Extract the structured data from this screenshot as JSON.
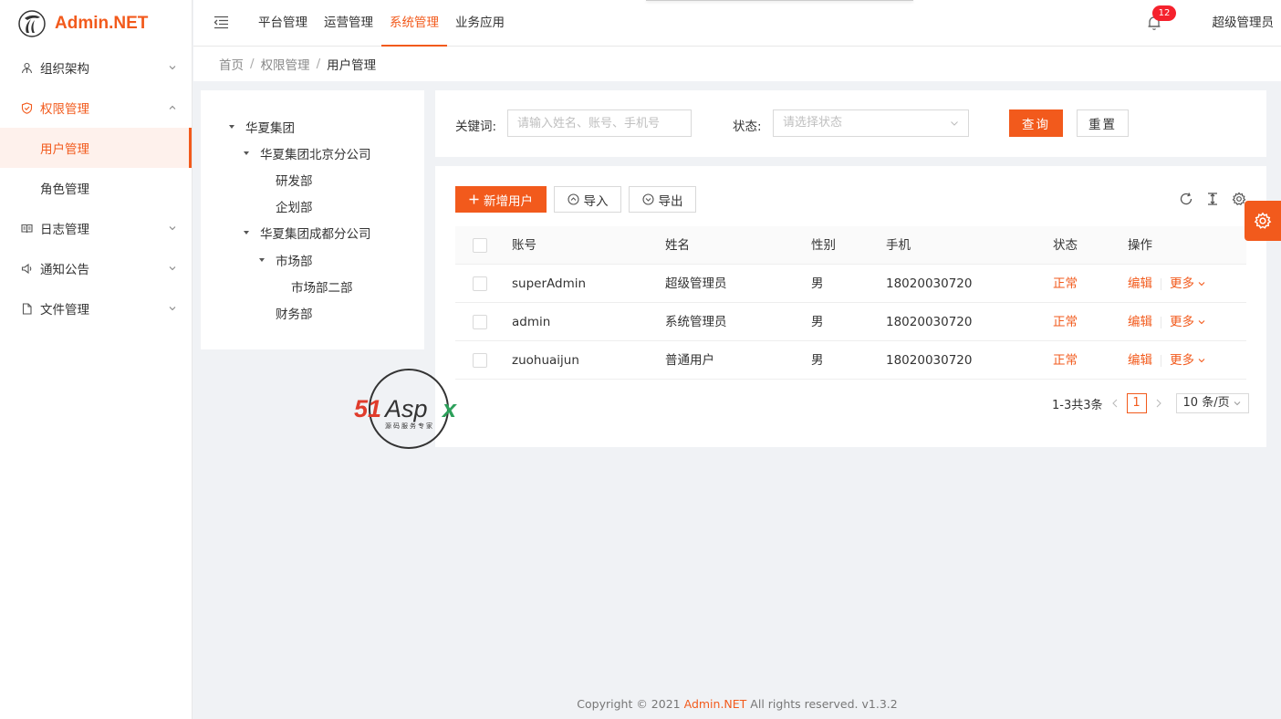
{
  "app": {
    "name": "Admin.NET",
    "brand_color": "#f25a1c"
  },
  "sidebar": {
    "items": [
      {
        "label": "组织架构",
        "icon": "org-icon",
        "expanded": false
      },
      {
        "label": "权限管理",
        "icon": "shield-icon",
        "expanded": true,
        "children": [
          {
            "label": "用户管理",
            "active": true
          },
          {
            "label": "角色管理",
            "active": false
          }
        ]
      },
      {
        "label": "日志管理",
        "icon": "book-icon",
        "expanded": false
      },
      {
        "label": "通知公告",
        "icon": "speaker-icon",
        "expanded": false
      },
      {
        "label": "文件管理",
        "icon": "file-icon",
        "expanded": false
      }
    ]
  },
  "topnav": {
    "items": [
      {
        "label": "平台管理",
        "active": false
      },
      {
        "label": "运营管理",
        "active": false
      },
      {
        "label": "系统管理",
        "active": true
      },
      {
        "label": "业务应用",
        "active": false
      }
    ],
    "notification_count": "12",
    "user_name": "超级管理员"
  },
  "breadcrumb": {
    "items": [
      "首页",
      "权限管理",
      "用户管理"
    ]
  },
  "org_tree": {
    "nodes": [
      {
        "label": "华夏集团",
        "level": 0,
        "expanded": true
      },
      {
        "label": "华夏集团北京分公司",
        "level": 1,
        "expanded": true
      },
      {
        "label": "研发部",
        "level": 2,
        "leaf": true
      },
      {
        "label": "企划部",
        "level": 2,
        "leaf": true
      },
      {
        "label": "华夏集团成都分公司",
        "level": 1,
        "expanded": true
      },
      {
        "label": "市场部",
        "level": 2,
        "expanded": true
      },
      {
        "label": "市场部二部",
        "level": 3,
        "leaf": true
      },
      {
        "label": "财务部",
        "level": 2,
        "leaf": true
      }
    ]
  },
  "search": {
    "keyword_label": "关键词:",
    "keyword_placeholder": "请输入姓名、账号、手机号",
    "status_label": "状态:",
    "status_placeholder": "请选择状态",
    "query_button": "查询",
    "reset_button": "重置"
  },
  "toolbar": {
    "add_button": "新增用户",
    "import_button": "导入",
    "export_button": "导出"
  },
  "table": {
    "columns": [
      "账号",
      "姓名",
      "性别",
      "手机",
      "状态",
      "操作"
    ],
    "rows": [
      {
        "account": "superAdmin",
        "name": "超级管理员",
        "gender": "男",
        "phone": "18020030720",
        "status": "正常"
      },
      {
        "account": "admin",
        "name": "系统管理员",
        "gender": "男",
        "phone": "18020030720",
        "status": "正常"
      },
      {
        "account": "zuohuaijun",
        "name": "普通用户",
        "gender": "男",
        "phone": "18020030720",
        "status": "正常"
      }
    ],
    "edit_label": "编辑",
    "more_label": "更多"
  },
  "pagination": {
    "summary": "1-3共3条",
    "current_page": "1",
    "page_size": "10 条/页"
  },
  "watermark": {
    "brand": "51Aspx",
    "tagline": "源码服务专家"
  },
  "footer": {
    "prefix": "Copyright © 2021",
    "brand": "Admin.NET",
    "suffix": "All rights reserved. v1.3.2"
  }
}
